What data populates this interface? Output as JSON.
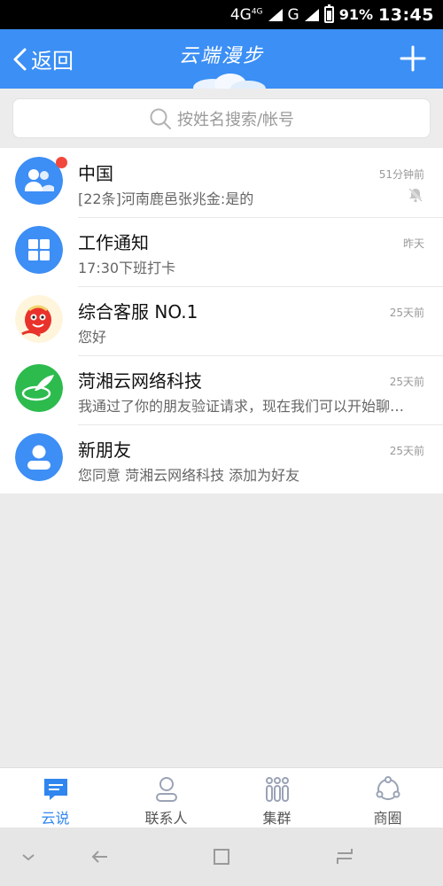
{
  "status_bar": {
    "network": "4G",
    "network_sup": "4G",
    "network2": "G",
    "battery": "91%",
    "time": "13:45"
  },
  "app_bar": {
    "back_label": "返回",
    "title": "云端漫步"
  },
  "search": {
    "placeholder": "按姓名搜索/帐号"
  },
  "chats": [
    {
      "name": "中国",
      "message": "[22条]河南鹿邑张兆金:是的",
      "time": "51分钟前",
      "icon": "group-icon",
      "unread": true,
      "muted": true
    },
    {
      "name": "工作通知",
      "message": "17:30下班打卡",
      "time": "昨天",
      "icon": "grid-icon",
      "unread": false,
      "muted": false
    },
    {
      "name": "综合客服 NO.1",
      "message": "您好",
      "time": "25天前",
      "icon": "mascot-avatar",
      "unread": false,
      "muted": false
    },
    {
      "name": "菏湘云网络科技",
      "message": "我通过了你的朋友验证请求，现在我们可以开始聊天了",
      "time": "25天前",
      "icon": "company-logo",
      "unread": false,
      "muted": false
    },
    {
      "name": "新朋友",
      "message": "您同意 菏湘云网络科技 添加为好友",
      "time": "25天前",
      "icon": "person-icon",
      "unread": false,
      "muted": false
    }
  ],
  "tabs": [
    {
      "label": "云说",
      "icon": "chat-bubble-icon",
      "active": true
    },
    {
      "label": "联系人",
      "icon": "contacts-icon",
      "active": false
    },
    {
      "label": "集群",
      "icon": "cluster-icon",
      "active": false
    },
    {
      "label": "商圈",
      "icon": "circle-icon",
      "active": false
    }
  ],
  "colors": {
    "primary": "#3b8ff5",
    "avatar_blue": "#3d8ef5",
    "company_green": "#2dbb4e",
    "badge_red": "#f2473c",
    "tab_active": "#2f86ef"
  }
}
